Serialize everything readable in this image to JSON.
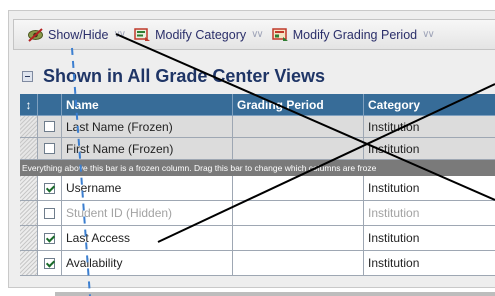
{
  "toolbar": {
    "show_hide_label": "Show/Hide",
    "modify_category_label": "Modify Category",
    "modify_grading_period_label": "Modify Grading Period"
  },
  "section": {
    "title": "Shown in All Grade Center Views"
  },
  "grid": {
    "columns": {
      "name": "Name",
      "grading_period": "Grading Period",
      "category": "Category"
    },
    "frozen_rows": [
      {
        "name": "Last Name (Frozen)",
        "grading_period": "",
        "category": "Institution",
        "checked": false
      },
      {
        "name": "First Name (Frozen)",
        "grading_period": "",
        "category": "Institution",
        "checked": false
      }
    ],
    "frozen_bar_text": "Everything above this bar is a frozen column. Drag this bar to change which columns are froze",
    "rows": [
      {
        "name": "Username",
        "grading_period": "",
        "category": "Institution",
        "checked": true,
        "hidden": false
      },
      {
        "name": "Student ID  (Hidden)",
        "grading_period": "",
        "category": "Institution",
        "checked": false,
        "hidden": true
      },
      {
        "name": "Last Access",
        "grading_period": "",
        "category": "Institution",
        "checked": true,
        "hidden": false
      },
      {
        "name": "Availability",
        "grading_period": "",
        "category": "Institution",
        "checked": true,
        "hidden": false
      }
    ]
  },
  "colors": {
    "header_blue": "#376c98",
    "title_blue": "#1f3566",
    "frozen_bar": "#7a7a7a",
    "annotation_dash": "#3c7fd0"
  },
  "icons": {
    "show_hide": "eye-slash-icon",
    "modify_category": "category-icon",
    "modify_grading_period": "grading-period-icon",
    "header_handle": "up-down-arrow-icon"
  }
}
